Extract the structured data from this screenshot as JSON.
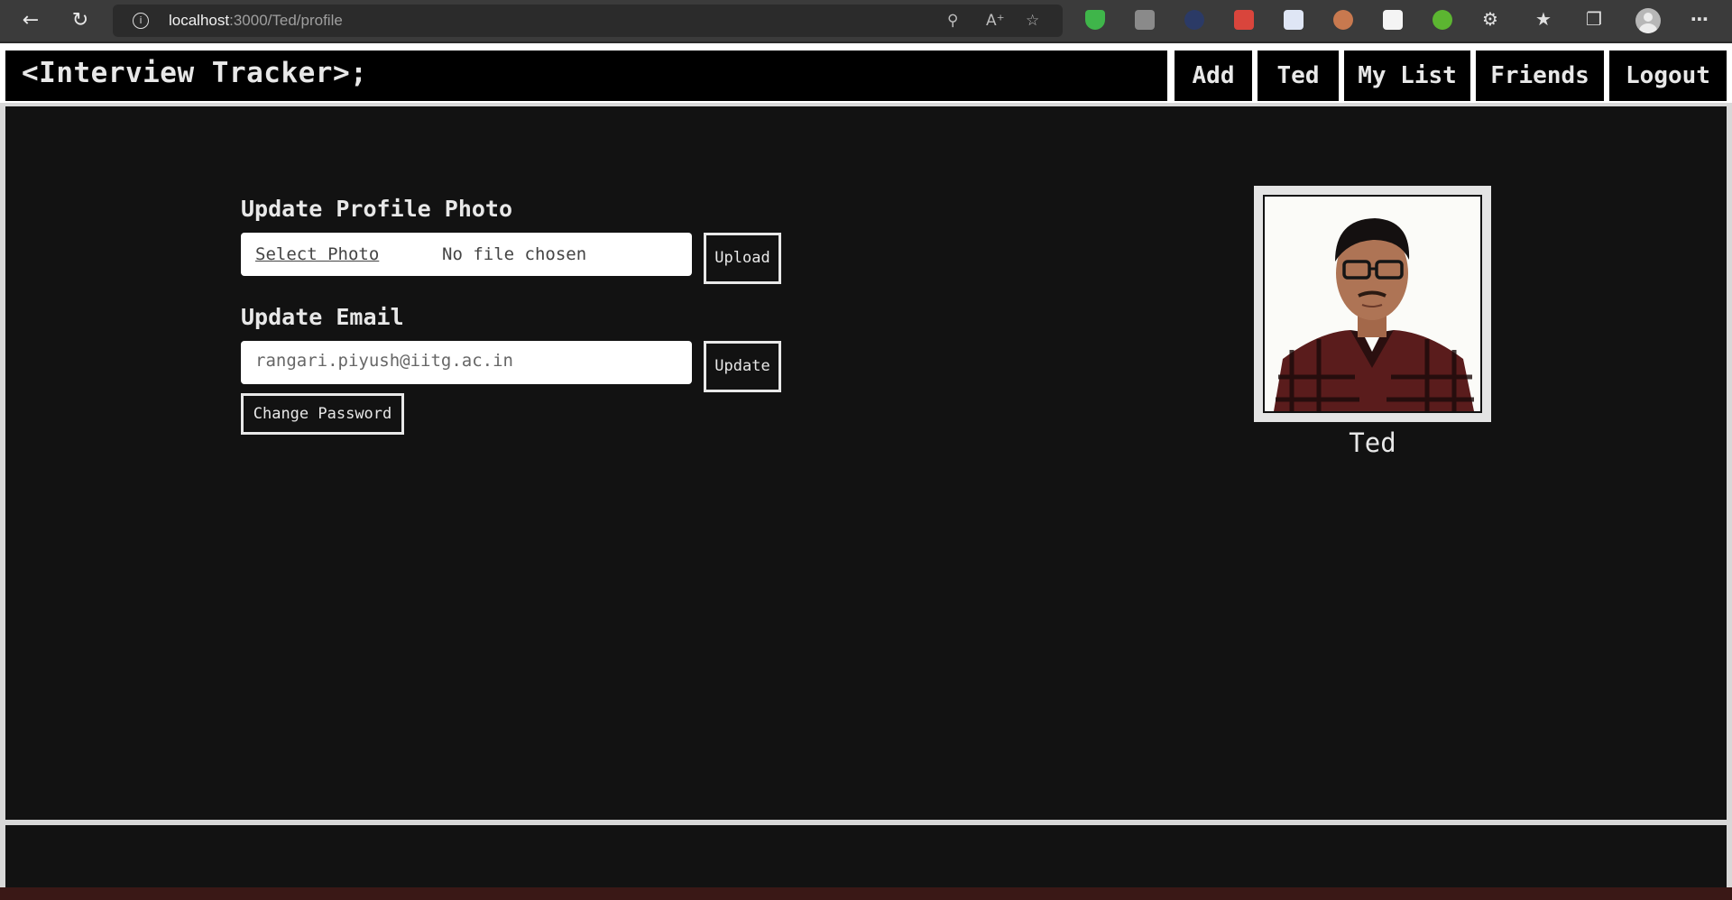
{
  "browser": {
    "url_host": "localhost",
    "url_path": ":3000/Ted/profile"
  },
  "header": {
    "logo": "<Interview Tracker>;",
    "nav": [
      {
        "label": "Add"
      },
      {
        "label": "Ted"
      },
      {
        "label": "My List"
      },
      {
        "label": "Friends"
      },
      {
        "label": "Logout"
      }
    ]
  },
  "profile_form": {
    "photo_section_title": "Update Profile Photo",
    "select_photo_label": "Select Photo",
    "file_status": "No file chosen",
    "upload_label": "Upload",
    "email_section_title": "Update Email",
    "email_value": "rangari.piyush@iitg.ac.in",
    "update_label": "Update",
    "change_password_label": "Change Password"
  },
  "profile_card": {
    "name": "Ted"
  }
}
